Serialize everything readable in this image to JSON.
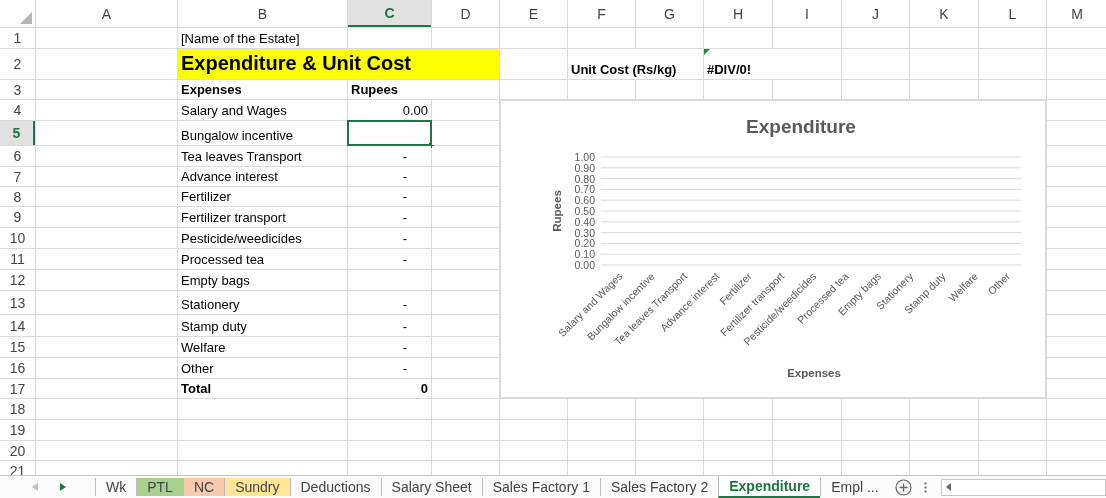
{
  "columns": [
    {
      "label": "A",
      "selected": false
    },
    {
      "label": "B",
      "selected": false
    },
    {
      "label": "C",
      "selected": true
    },
    {
      "label": "D",
      "selected": false
    },
    {
      "label": "E",
      "selected": false
    },
    {
      "label": "F",
      "selected": false
    },
    {
      "label": "G",
      "selected": false
    },
    {
      "label": "H",
      "selected": false
    },
    {
      "label": "I",
      "selected": false
    },
    {
      "label": "J",
      "selected": false
    },
    {
      "label": "K",
      "selected": false
    },
    {
      "label": "L",
      "selected": false
    },
    {
      "label": "M",
      "selected": false
    }
  ],
  "rows": [
    {
      "number": "1",
      "selected": false,
      "cells": {
        "B": {
          "kind": "text",
          "text": "[Name of the Estate]"
        }
      }
    },
    {
      "number": "2",
      "selected": false,
      "cells": {
        "B": {
          "kind": "title",
          "text": "Expenditure & Unit Cost"
        },
        "F": {
          "kind": "label",
          "text": "Unit Cost (Rs/kg)"
        },
        "H": {
          "kind": "label",
          "error": true,
          "text": "#DIV/0!"
        }
      }
    },
    {
      "number": "3",
      "selected": false,
      "cells": {
        "B": {
          "kind": "label",
          "text": "Expenses"
        },
        "C": {
          "kind": "label",
          "text": "Rupees"
        }
      }
    },
    {
      "number": "4",
      "selected": false,
      "cells": {
        "B": {
          "kind": "text",
          "text": "Salary and Wages"
        },
        "C": {
          "kind": "number",
          "text": "0.00"
        }
      }
    },
    {
      "number": "5",
      "selected": true,
      "cells": {
        "B": {
          "kind": "text",
          "text": "Bungalow incentive"
        },
        "C": {
          "kind": "number",
          "selected": true
        }
      }
    },
    {
      "number": "6",
      "selected": false,
      "cells": {
        "B": {
          "kind": "text",
          "text": "Tea leaves Transport"
        },
        "C": {
          "kind": "dash",
          "text": "-"
        }
      }
    },
    {
      "number": "7",
      "selected": false,
      "cells": {
        "B": {
          "kind": "text",
          "text": "Advance interest"
        },
        "C": {
          "kind": "dash",
          "text": "-"
        }
      }
    },
    {
      "number": "8",
      "selected": false,
      "cells": {
        "B": {
          "kind": "text",
          "text": "Fertilizer"
        },
        "C": {
          "kind": "dash",
          "text": "-"
        }
      }
    },
    {
      "number": "9",
      "selected": false,
      "cells": {
        "B": {
          "kind": "text",
          "text": "Fertilizer transport"
        },
        "C": {
          "kind": "dash",
          "text": "-"
        }
      }
    },
    {
      "number": "10",
      "selected": false,
      "cells": {
        "B": {
          "kind": "text",
          "text": "Pesticide/weedicides"
        },
        "C": {
          "kind": "dash",
          "text": "-"
        }
      }
    },
    {
      "number": "11",
      "selected": false,
      "cells": {
        "B": {
          "kind": "text",
          "text": "Processed tea"
        },
        "C": {
          "kind": "dash",
          "text": "-"
        }
      }
    },
    {
      "number": "12",
      "selected": false,
      "cells": {
        "B": {
          "kind": "text",
          "text": "Empty bags"
        }
      }
    },
    {
      "number": "13",
      "selected": false,
      "cells": {
        "B": {
          "kind": "text",
          "text": "Stationery"
        },
        "C": {
          "kind": "dash",
          "text": "-"
        }
      }
    },
    {
      "number": "14",
      "selected": false,
      "cells": {
        "B": {
          "kind": "text",
          "text": "Stamp duty"
        },
        "C": {
          "kind": "dash",
          "text": "-"
        }
      }
    },
    {
      "number": "15",
      "selected": false,
      "cells": {
        "B": {
          "kind": "text",
          "text": "Welfare"
        },
        "C": {
          "kind": "dash",
          "text": "-"
        }
      }
    },
    {
      "number": "16",
      "selected": false,
      "cells": {
        "B": {
          "kind": "text",
          "text": "Other"
        },
        "C": {
          "kind": "dash",
          "text": "-"
        }
      }
    },
    {
      "number": "17",
      "selected": false,
      "cells": {
        "B": {
          "kind": "label",
          "text": "Total"
        },
        "C": {
          "kind": "total",
          "text": "0"
        }
      }
    },
    {
      "number": "18",
      "selected": false,
      "cells": {}
    },
    {
      "number": "19",
      "selected": false,
      "cells": {}
    },
    {
      "number": "20",
      "selected": false,
      "cells": {}
    },
    {
      "number": "21",
      "selected": false,
      "cells": {}
    }
  ],
  "chart": {
    "chart_data": {
      "type": "bar",
      "title": "Expenditure",
      "xlabel": "Expenses",
      "ylabel": "Rupees",
      "categories": [
        "Salary and Wages",
        "Bungalow incentive",
        "Tea leaves Transport",
        "Advance interest",
        "Fertilizer",
        "Fertilizer transport",
        "Pesticide/weedicides",
        "Processed tea",
        "Empty bags",
        "Stationery",
        "Stamp duty",
        "Welfare",
        "Other"
      ],
      "values": [
        0,
        0,
        0,
        0,
        0,
        0,
        0,
        0,
        null,
        0,
        0,
        0,
        0
      ],
      "grid": true,
      "ylim": [
        0,
        1
      ],
      "yticks": [
        {
          "value": 0,
          "label": "0.00"
        },
        {
          "value": 0.1,
          "label": "0.10"
        },
        {
          "value": 0.2,
          "label": "0.20"
        },
        {
          "value": 0.3,
          "label": "0.30"
        },
        {
          "value": 0.4,
          "label": "0.40"
        },
        {
          "value": 0.5,
          "label": "0.50"
        },
        {
          "value": 0.6,
          "label": "0.60"
        },
        {
          "value": 0.7,
          "label": "0.70"
        },
        {
          "value": 0.8,
          "label": "0.80"
        },
        {
          "value": 0.9,
          "label": "0.90"
        },
        {
          "value": 1,
          "label": "1.00"
        }
      ]
    }
  },
  "sheet_tabs": [
    {
      "label": "Wk",
      "selected": false
    },
    {
      "label": "PTL",
      "selected": false,
      "color": "#a9d08e"
    },
    {
      "label": "NC",
      "selected": false,
      "color": "#f8cbad"
    },
    {
      "label": "Sundry",
      "selected": false,
      "color": "#ffe699"
    },
    {
      "label": "Deductions",
      "selected": false
    },
    {
      "label": "Salary Sheet",
      "selected": false
    },
    {
      "label": "Sales Factory 1",
      "selected": false
    },
    {
      "label": "Sales Factory 2",
      "selected": false
    },
    {
      "label": "Expenditure",
      "selected": true
    },
    {
      "label": "Empl ...",
      "selected": false
    }
  ]
}
